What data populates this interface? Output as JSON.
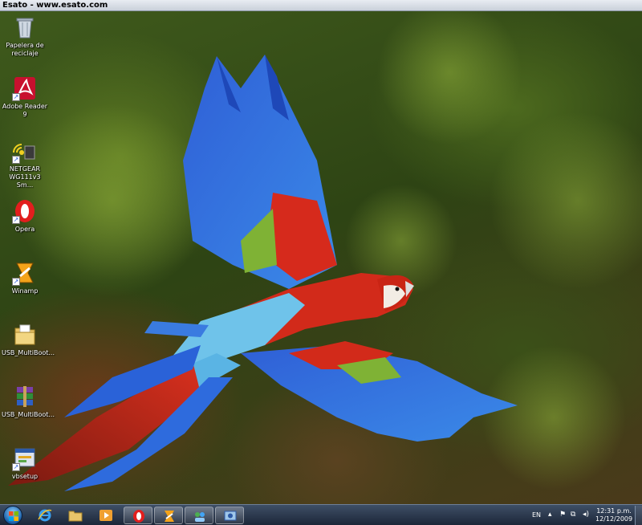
{
  "window": {
    "title": "Esato - www.esato.com"
  },
  "desktop_icons": [
    {
      "label": "Papelera de reciclaje",
      "icon": "recycle-bin-icon"
    },
    {
      "label": "Adobe Reader 9",
      "icon": "adobe-reader-icon"
    },
    {
      "label": "NETGEAR WG111v3 Sm...",
      "icon": "netgear-icon"
    },
    {
      "label": "Opera",
      "icon": "opera-icon"
    },
    {
      "label": "Winamp",
      "icon": "winamp-icon"
    },
    {
      "label": "USB_MultiBoot...",
      "icon": "folder-icon"
    },
    {
      "label": "USB_MultiBoot...",
      "icon": "winrar-icon"
    },
    {
      "label": "vbsetup",
      "icon": "setup-icon"
    }
  ],
  "taskbar": {
    "pinned": [
      "internet-explorer-icon",
      "explorer-folder-icon",
      "media-player-icon",
      "opera-icon",
      "winamp-icon",
      "network-icon",
      "control-panel-icon"
    ],
    "tray": {
      "language": "EN",
      "time": "12:31 p.m.",
      "date": "12/12/2009"
    }
  },
  "colors": {
    "taskbar": "#1c2638",
    "accent": "#1a5fa8"
  }
}
